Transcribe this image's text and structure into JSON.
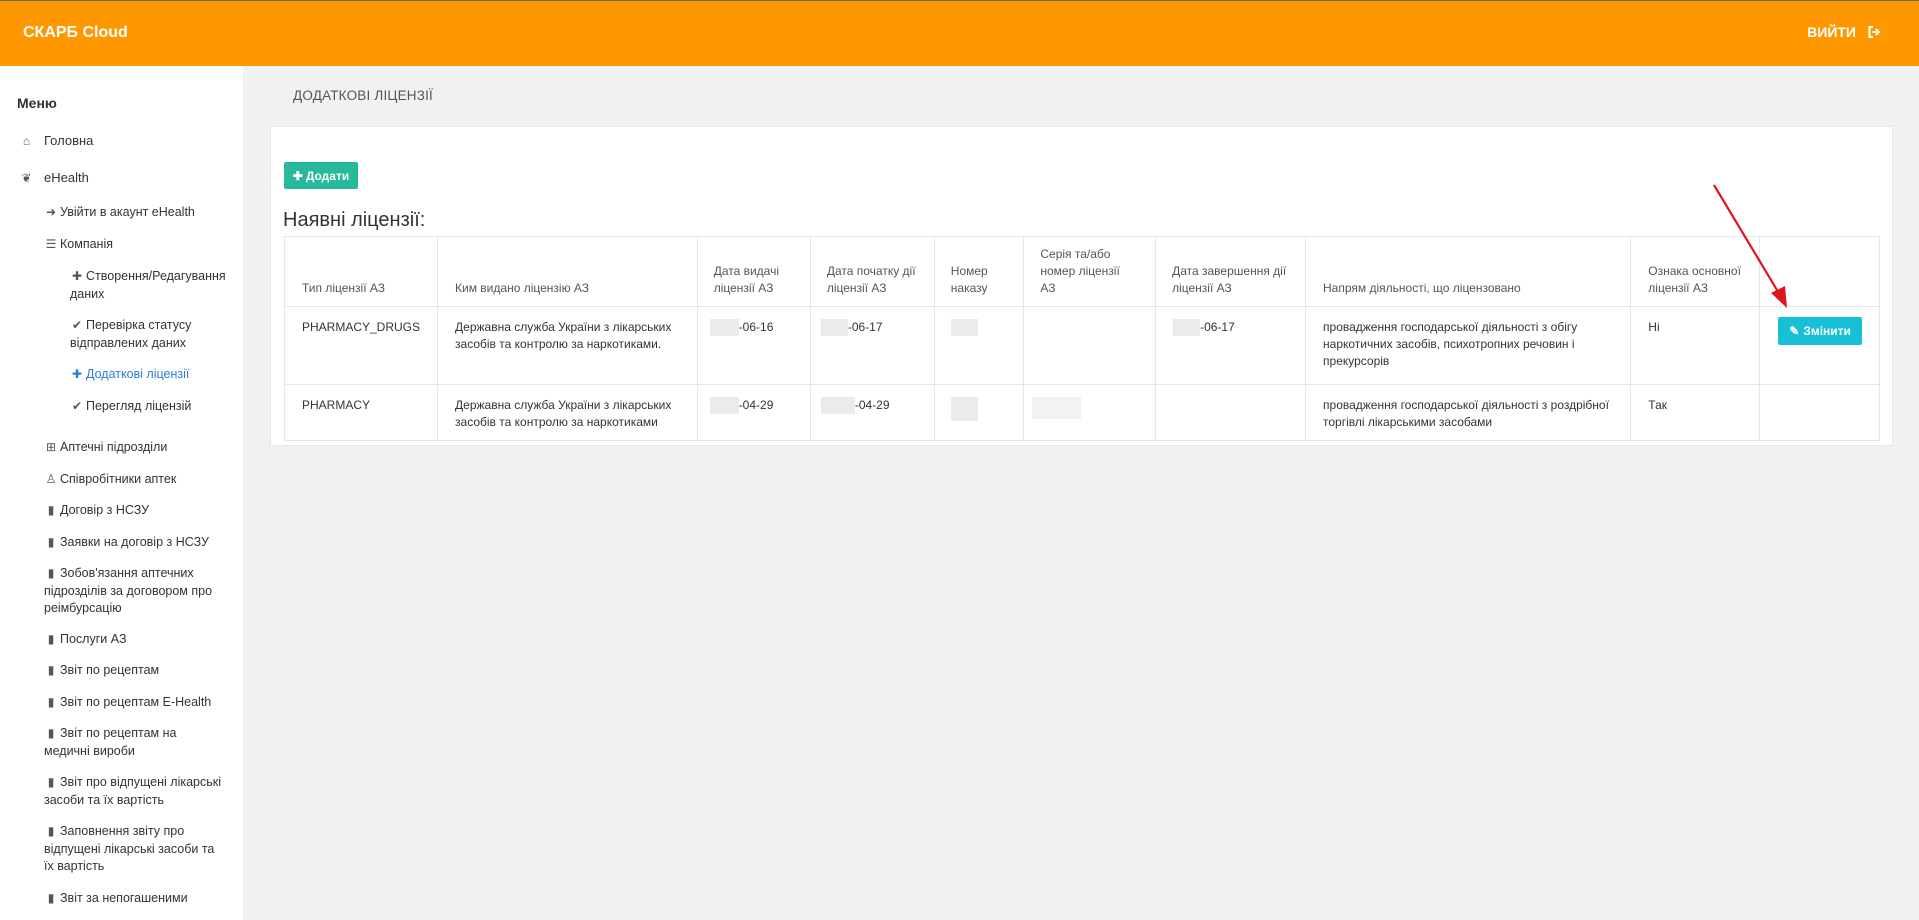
{
  "app": {
    "title": "СКАРБ Cloud",
    "logout_label": "ВИЙТИ"
  },
  "sidebar": {
    "menu_title": "Меню",
    "items": [
      {
        "label": "Головна",
        "icon": "home-icon"
      },
      {
        "label": "eHealth",
        "icon": "leaf-icon"
      },
      {
        "label": "Увійти в акаунт eHealth",
        "icon": "sign-in-icon"
      },
      {
        "label": "Компанія",
        "icon": "database-icon"
      },
      {
        "label": "Створення/Редагування даних",
        "icon": "plus-icon"
      },
      {
        "label": "Перевірка статусу відправлених даних",
        "icon": "check-icon"
      },
      {
        "label": "Додаткові ліцензії",
        "icon": "plus-icon",
        "active": true
      },
      {
        "label": "Перегляд ліцензій",
        "icon": "check-icon"
      },
      {
        "label": "Аптечні підрозділи",
        "icon": "plus-square-icon"
      },
      {
        "label": "Співробітники аптек",
        "icon": "user-md-icon"
      },
      {
        "label": "Договір з НСЗУ",
        "icon": "file-icon"
      },
      {
        "label": "Заявки на договір з НСЗУ",
        "icon": "file-icon"
      },
      {
        "label": "Зобов'язання аптечних підрозділів за договором про реімбурсацію",
        "icon": "file-icon"
      },
      {
        "label": "Послуги АЗ",
        "icon": "file-icon"
      },
      {
        "label": "Звіт по рецептам",
        "icon": "file-icon"
      },
      {
        "label": "Звіт по рецептам E-Health",
        "icon": "file-icon"
      },
      {
        "label": "Звіт по рецептам на медичні вироби",
        "icon": "file-icon"
      },
      {
        "label": "Звіт про відпущені лікарські засоби та їх вартість",
        "icon": "file-icon"
      },
      {
        "label": "Заповнення звіту про відпущені лікарські засоби та їх вартість",
        "icon": "file-icon"
      },
      {
        "label": "Звіт за непогашеними",
        "icon": "file-icon"
      }
    ]
  },
  "page": {
    "header": "ДОДАТКОВІ ЛІЦЕНЗІЇ",
    "add_button": "Додати",
    "section_title": "Наявні ліцензії:"
  },
  "table": {
    "columns": [
      "Тип ліцензії АЗ",
      "Ким видано ліцензію АЗ",
      "Дата видачі ліцензії АЗ",
      "Дата початку дії ліцензії АЗ",
      "Номер наказу",
      "Серія та/або номер ліцензії АЗ",
      "Дата завершення дії ліцензії АЗ",
      "Напрям діяльності, що ліцензовано",
      "Ознака основної ліцензії АЗ",
      ""
    ],
    "rows": [
      {
        "type": "PHARMACY_DRUGS",
        "issuer": "Державна служба України з лікарських засобів та контролю за наркотиками.",
        "issue_date": "-06-16",
        "start_date": "-06-17",
        "order_number": "",
        "series": "",
        "end_date": "-06-17",
        "activity": "провадження господарської діяльності з обігу наркотичних засобів, психотропних речовин і прекурсорів",
        "is_main": "Ні",
        "action": "Змінити"
      },
      {
        "type": "PHARMACY",
        "issuer": "Державна служба України з лікарських засобів та контролю за наркотиками",
        "issue_date": "-04-29",
        "start_date": "-04-29",
        "order_number": "",
        "series": "",
        "end_date": "",
        "activity": "провадження господарської діяльності з роздрібної торгівлі лікарськими засобами",
        "is_main": "Так",
        "action": ""
      }
    ]
  },
  "colors": {
    "topbar": "#ff9800",
    "add_button": "#26b99a",
    "edit_button": "#17c0d6",
    "arrow": "#e0141e",
    "active_link": "#2a7fd4"
  }
}
